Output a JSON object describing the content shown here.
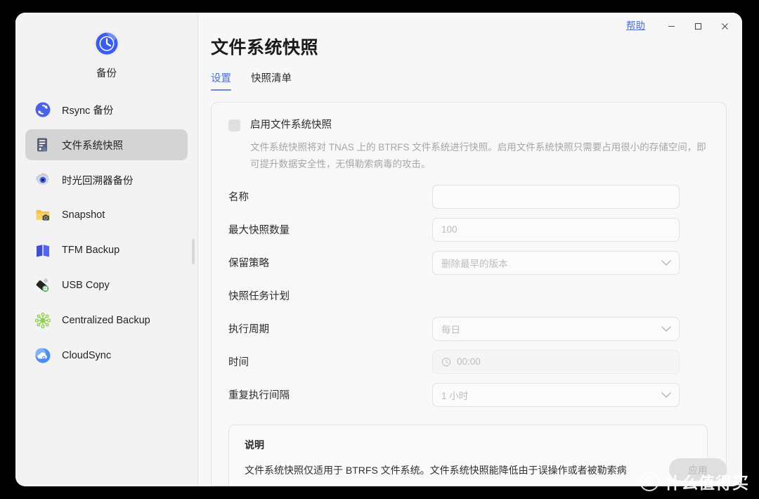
{
  "window": {
    "help_label": "帮助",
    "minimize_icon": "minimize-icon",
    "maximize_icon": "maximize-icon",
    "close_icon": "close-icon"
  },
  "sidebar": {
    "app_name": "备份",
    "app_icon": "clock-backup-icon",
    "items": [
      {
        "label": "Rsync 备份",
        "icon": "rsync-sync-icon",
        "selected": false
      },
      {
        "label": "文件系统快照",
        "icon": "filesystem-snapshot-icon",
        "selected": true
      },
      {
        "label": "时光回溯器备份",
        "icon": "time-machine-gear-icon",
        "selected": false
      },
      {
        "label": "Snapshot",
        "icon": "folder-camera-icon",
        "selected": false
      },
      {
        "label": "TFM Backup",
        "icon": "tfm-book-icon",
        "selected": false
      },
      {
        "label": "USB Copy",
        "icon": "usb-drive-icon",
        "selected": false
      },
      {
        "label": "Centralized Backup",
        "icon": "network-nodes-icon",
        "selected": false
      },
      {
        "label": "CloudSync",
        "icon": "cloud-sync-icon",
        "selected": false
      }
    ]
  },
  "main": {
    "title": "文件系统快照",
    "tabs": [
      {
        "label": "设置",
        "active": true
      },
      {
        "label": "快照清单",
        "active": false
      }
    ],
    "enable": {
      "checkbox_state": "unchecked",
      "title": "启用文件系统快照",
      "description": "文件系统快照将对 TNAS 上的 BTRFS 文件系统进行快照。启用文件系统快照只需要占用很小的存储空间，即可提升数据安全性，无惧勒索病毒的攻击。"
    },
    "form": [
      {
        "label": "名称",
        "type": "text",
        "value": "",
        "placeholder": ""
      },
      {
        "label": "最大快照数量",
        "type": "text",
        "value": "",
        "placeholder": "100"
      },
      {
        "label": "保留策略",
        "type": "select",
        "value": "删除最早的版本"
      },
      {
        "label": "快照任务计划",
        "type": "section"
      },
      {
        "label": "执行周期",
        "type": "select",
        "value": "每日"
      },
      {
        "label": "时间",
        "type": "time",
        "value": "00:00",
        "icon": "clock-icon"
      },
      {
        "label": "重复执行间隔",
        "type": "select",
        "value": "1 小时"
      }
    ],
    "note": {
      "title": "说明",
      "body": "文件系统快照仅适用于 BTRFS 文件系统。文件系统快照能降低由于误操作或者被勒索病"
    },
    "apply_label": "应用"
  },
  "watermark": {
    "badge": "值",
    "text": "什么值得买"
  },
  "colors": {
    "accent": "#4b6fd4",
    "tab_underline": "#6d8ae0",
    "sidebar_bg": "#f3f3f3",
    "selected_item_bg": "#d4d4d5",
    "window_bg": "#f7f7f7",
    "desc_text": "#a6a6a6",
    "placeholder": "#bdbdbd"
  }
}
